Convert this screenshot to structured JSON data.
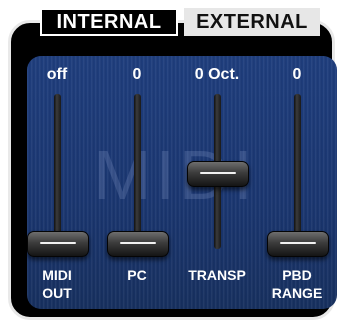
{
  "tabs": [
    {
      "label": "INTERNAL",
      "selected": false
    },
    {
      "label": "EXTERNAL",
      "selected": true
    }
  ],
  "panel": {
    "watermark": "MIDI"
  },
  "sliders": [
    {
      "value_text": "off",
      "label_line1": "MIDI",
      "label_line2": "OUT",
      "level": 0.0
    },
    {
      "value_text": "0",
      "label_line1": "PC",
      "label_line2": "",
      "level": 0.0
    },
    {
      "value_text": "0 Oct.",
      "label_line1": "TRANSP",
      "label_line2": "",
      "level": 0.5
    },
    {
      "value_text": "0",
      "label_line1": "PBD",
      "label_line2": "RANGE",
      "level": 0.0
    }
  ],
  "colors": {
    "panel": "#1d3a78",
    "frame": "#000000",
    "selected_tab": "#e7e7e7"
  }
}
